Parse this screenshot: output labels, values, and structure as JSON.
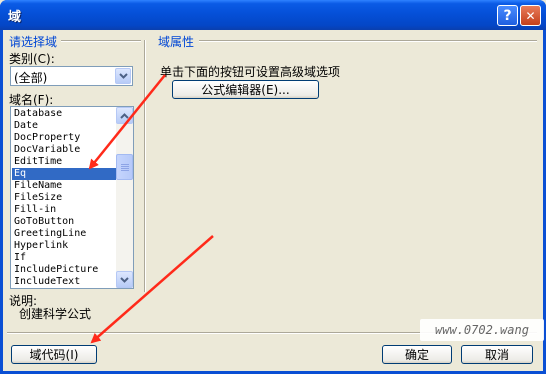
{
  "window": {
    "title": "域",
    "help_glyph": "?",
    "close_glyph": "✕"
  },
  "left_panel": {
    "group_title": "请选择域",
    "category_label": "类别(C):",
    "category_value": "(全部)",
    "field_names_label": "域名(F):",
    "field_names": [
      "Database",
      "Date",
      "DocProperty",
      "DocVariable",
      "EditTime",
      "Eq",
      "FileName",
      "FileSize",
      "Fill-in",
      "GoToButton",
      "GreetingLine",
      "Hyperlink",
      "If",
      "IncludePicture",
      "IncludeText"
    ],
    "selected_field": "Eq",
    "description_label": "说明:",
    "description_text": "创建科学公式"
  },
  "right_panel": {
    "group_title": "域属性",
    "instruction": "单击下面的按钮可设置高级域选项",
    "formula_editor_button": "公式编辑器(E)..."
  },
  "footer": {
    "field_codes_button": "域代码(I)",
    "ok_button": "确定",
    "cancel_button": "取消",
    "watermark": "www.0702.wang"
  },
  "colors": {
    "titlebar": "#0550d8",
    "group_title": "#0046d5",
    "selection": "#316ac5",
    "annotation_arrow": "#ff2a1a"
  },
  "icons": [
    "help-icon",
    "close-icon",
    "dropdown-arrow-icon",
    "scroll-up-icon",
    "scroll-down-icon",
    "annotation-arrow-icon"
  ]
}
